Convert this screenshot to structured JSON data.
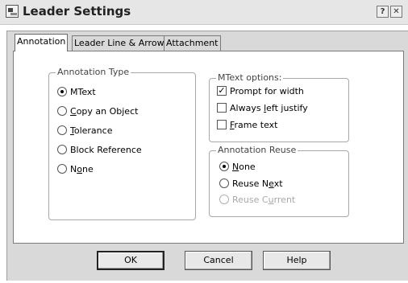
{
  "window": {
    "title": "Leader Settings",
    "help_glyph": "?",
    "close_glyph": "✕"
  },
  "tabs": [
    {
      "label": "Annotation",
      "active": true
    },
    {
      "label": "Leader Line & Arrow",
      "active": false
    },
    {
      "label": "Attachment",
      "active": false
    }
  ],
  "annotation_type": {
    "legend": "Annotation Type",
    "options": [
      {
        "label": "MText",
        "selected": true
      },
      {
        "pre": "",
        "u": "C",
        "post": "opy an Object",
        "selected": false
      },
      {
        "pre": "",
        "u": "T",
        "post": "olerance",
        "selected": false
      },
      {
        "label": "Block Reference",
        "selected": false
      },
      {
        "pre": "N",
        "u": "o",
        "post": "ne",
        "selected": false
      }
    ]
  },
  "mtext_options": {
    "legend": "MText options:",
    "checks": [
      {
        "label": "Prompt for width",
        "checked": true,
        "mark": "✓"
      },
      {
        "pre": "Always ",
        "u": "l",
        "post": "eft justify",
        "checked": false
      },
      {
        "pre": "",
        "u": "F",
        "post": "rame text",
        "checked": false
      }
    ]
  },
  "annotation_reuse": {
    "legend": "Annotation Reuse",
    "options": [
      {
        "pre": "",
        "u": "N",
        "post": "one",
        "selected": true,
        "disabled": false
      },
      {
        "pre": "Reuse N",
        "u": "e",
        "post": "xt",
        "selected": false,
        "disabled": false
      },
      {
        "pre": "Reuse C",
        "u": "u",
        "post": "rrent",
        "selected": false,
        "disabled": true
      }
    ]
  },
  "buttons": {
    "ok": "OK",
    "cancel": "Cancel",
    "help": "Help"
  }
}
